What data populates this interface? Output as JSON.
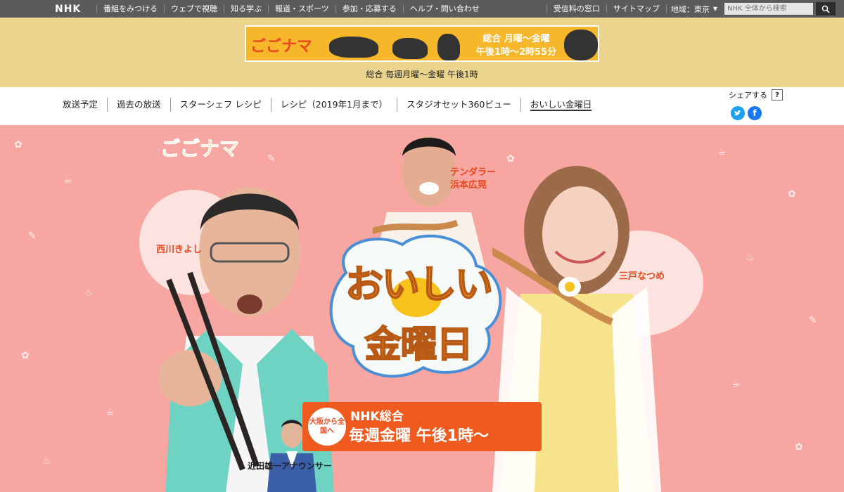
{
  "globalbar": {
    "logo": "NHK",
    "links": [
      "番組をみつける",
      "ウェブで視聴",
      "知る学ぶ",
      "報道・スポーツ",
      "参加・応募する",
      "ヘルプ・問い合わせ"
    ],
    "right_links": [
      "受信料の窓口",
      "サイトマップ"
    ],
    "region": "地域：東京",
    "search_placeholder": "NHK 全体から検索"
  },
  "banner": {
    "logo_text": "ごごナマ",
    "schedule_line1": "総合 月曜～金曜",
    "schedule_line2": "午後1時～2時55分",
    "subtitle": "総合 毎週月曜～金曜 午後1時"
  },
  "nav": {
    "items": [
      "放送予定",
      "過去の放送",
      "スターシェフ レシピ",
      "レシピ（2019年1月まで）",
      "スタジオセット360ビュー",
      "おいしい金曜日"
    ],
    "active_index": 5,
    "share_label": "シェアする",
    "help_label": "?"
  },
  "hero": {
    "show_logo": "ごごナマ",
    "title_line1": "おいしい",
    "title_line2": "金曜日",
    "names": {
      "left": "西川きよし",
      "center_top": "テンダラー",
      "center_bottom": "浜本広晃",
      "right": "三戸なつめ"
    },
    "promo": {
      "bubble": "大阪から全国へ",
      "line1": "NHK総合",
      "line2": "毎週金曜 午後1時～"
    },
    "announcer": "近田雄一アナウンサー"
  },
  "colors": {
    "globalbar": "#5b5b5b",
    "banner_bg": "#ead48e",
    "hero_bg": "#f7a6a1",
    "accent": "#e8461d",
    "twitter": "#1da1f2",
    "facebook": "#1877f2"
  }
}
